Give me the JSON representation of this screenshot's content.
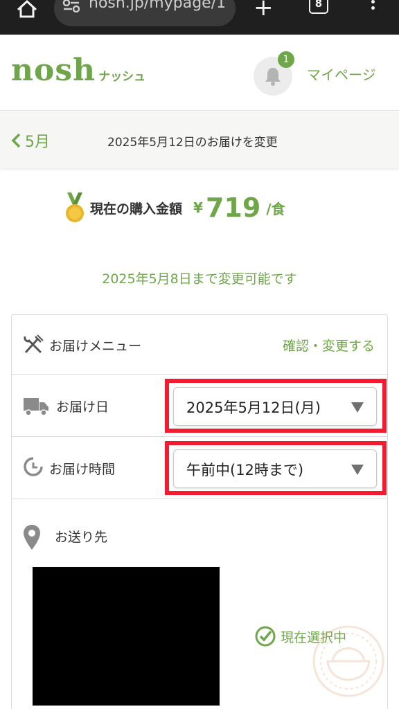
{
  "browser": {
    "url": "nosh.jp/mypage/1",
    "tab_count": "8"
  },
  "header": {
    "logo_main": "nosh",
    "logo_sub": "ナッシュ",
    "notification_count": "1",
    "mypage_label": "マイページ"
  },
  "subheader": {
    "back_label": "5月",
    "title": "2025年5月12日のお届けを変更"
  },
  "price": {
    "label": "現在の購入金額",
    "currency": "¥",
    "value": "719",
    "unit": "/食"
  },
  "deadline_text": "2025年5月8日まで変更可能です",
  "delivery": {
    "menu_label": "お届けメニュー",
    "menu_action": "確認・変更する",
    "date_label": "お届け日",
    "date_value": "2025年5月12日(月)",
    "time_label": "お届け時間",
    "time_value": "午前中(12時まで)",
    "address_label": "お送り先",
    "selected_label": "現在選択中"
  },
  "colors": {
    "brand_green": "#6fa64a",
    "highlight_red": "#f21c30"
  },
  "icons": [
    "home-icon",
    "site-info-icon",
    "plus-icon",
    "tabs-icon",
    "more-icon",
    "bell-icon",
    "chevron-left-icon",
    "medal-icon",
    "cutlery-icon",
    "truck-icon",
    "clock-icon",
    "map-pin-icon",
    "check-circle-icon",
    "rice-bowl-watermark-icon"
  ]
}
